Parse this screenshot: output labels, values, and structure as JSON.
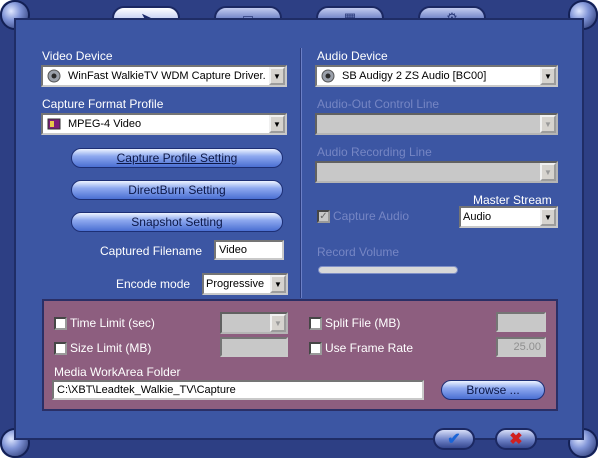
{
  "tabs": [
    {
      "icon": "capture-tab-icon",
      "glyph": "➤",
      "active": true
    },
    {
      "icon": "playback-tab-icon",
      "glyph": "▭"
    },
    {
      "icon": "schedule-tab-icon",
      "glyph": "▦"
    },
    {
      "icon": "settings-tab-icon",
      "glyph": "⚙"
    }
  ],
  "video": {
    "device_label": "Video Device",
    "device_value": "WinFast WalkieTV WDM Capture Driver.",
    "profile_label": "Capture Format Profile",
    "profile_value": "MPEG-4 Video",
    "capture_profile_setting": "Capture Profile Setting",
    "directburn_setting": "DirectBurn Setting",
    "snapshot_setting": "Snapshot Setting",
    "filename_label": "Captured Filename",
    "filename_value": "Video",
    "encode_label": "Encode mode",
    "encode_value": "Progressive"
  },
  "audio": {
    "device_label": "Audio Device",
    "device_value": "SB Audigy 2 ZS Audio [BC00]",
    "out_control_label": "Audio-Out Control Line",
    "recording_line_label": "Audio Recording Line",
    "master_stream_label": "Master Stream",
    "master_stream_value": "Audio",
    "capture_audio_label": "Capture Audio",
    "record_volume_label": "Record Volume"
  },
  "limits": {
    "time_limit_label": "Time Limit (sec)",
    "size_limit_label": "Size Limit (MB)",
    "split_file_label": "Split File (MB)",
    "frame_rate_label": "Use Frame Rate",
    "frame_rate_value": "25.00",
    "workarea_label": "Media WorkArea Folder",
    "workarea_value": "C:\\XBT\\Leadtek_Walkie_TV\\Capture",
    "browse_label": "Browse ..."
  },
  "colors": {
    "frame": "#2d3f84",
    "panel": "#3c56a3",
    "bottom_panel": "#8d5e7f",
    "pill_button": "#6f8fe6"
  }
}
